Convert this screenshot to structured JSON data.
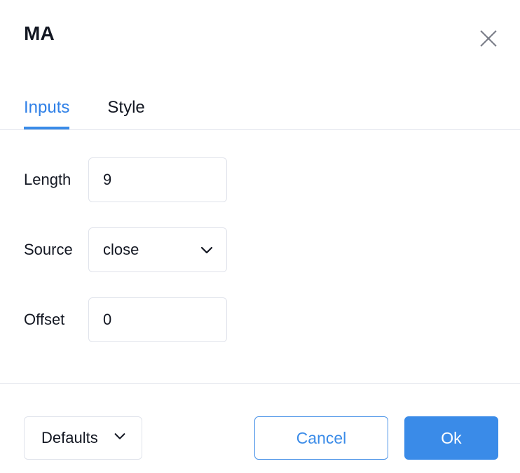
{
  "dialog": {
    "title": "MA",
    "close_icon": "close-icon"
  },
  "tabs": [
    {
      "label": "Inputs",
      "active": true
    },
    {
      "label": "Style",
      "active": false
    }
  ],
  "fields": [
    {
      "label": "Length",
      "value": "9",
      "type": "text"
    },
    {
      "label": "Source",
      "value": "close",
      "type": "select",
      "chevron_icon": "chevron-down-icon"
    },
    {
      "label": "Offset",
      "value": "0",
      "type": "text"
    }
  ],
  "footer": {
    "defaults_label": "Defaults",
    "defaults_chevron_icon": "chevron-down-icon",
    "cancel_label": "Cancel",
    "ok_label": "Ok"
  },
  "colors": {
    "accent": "#3a8be8",
    "accent_text": "#2f80e7",
    "border": "#e0e3eb",
    "text": "#131722",
    "icon_gray": "#787b86",
    "background": "#ffffff"
  }
}
